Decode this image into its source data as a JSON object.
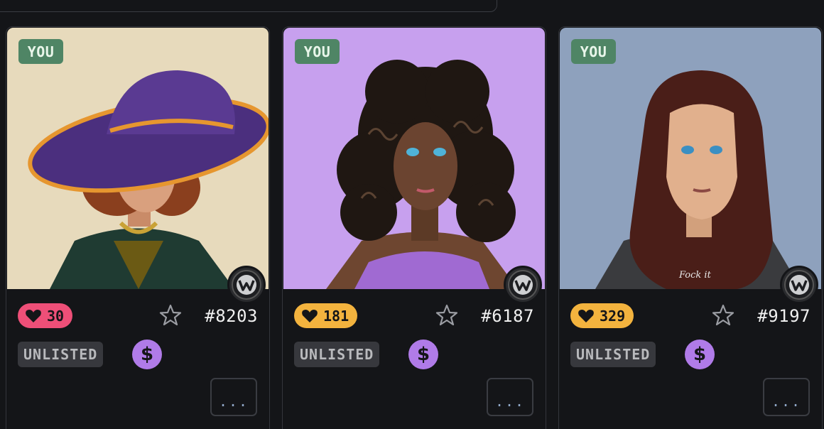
{
  "cards": [
    {
      "owner_badge": "YOU",
      "likes": "30",
      "likes_color": "#ee4f78",
      "token_id": "#8203",
      "status": "UNLISTED",
      "more_label": "...",
      "art_background": "#ede0c4",
      "portrait": "woman-purple-hat"
    },
    {
      "owner_badge": "YOU",
      "likes": "181",
      "likes_color": "#f3b33e",
      "token_id": "#6187",
      "status": "UNLISTED",
      "more_label": "...",
      "art_background": "#c7a0ee",
      "portrait": "woman-curly-hair"
    },
    {
      "owner_badge": "YOU",
      "likes": "329",
      "likes_color": "#f3b33e",
      "token_id": "#9197",
      "status": "UNLISTED",
      "more_label": "...",
      "art_background": "#8ea1bd",
      "portrait": "woman-long-hair-hoodie",
      "hoodie_text": "Fock it"
    }
  ],
  "icons": {
    "heart": "heart-icon",
    "star": "star-icon",
    "dollar": "dollar-icon",
    "dollar_glyph": "$",
    "platform": "w-logo-icon"
  },
  "colors": {
    "you_badge": "#4f8565",
    "unlisted_badge": "#37383d",
    "dollar_badge": "#b07be8",
    "background": "#141518"
  }
}
